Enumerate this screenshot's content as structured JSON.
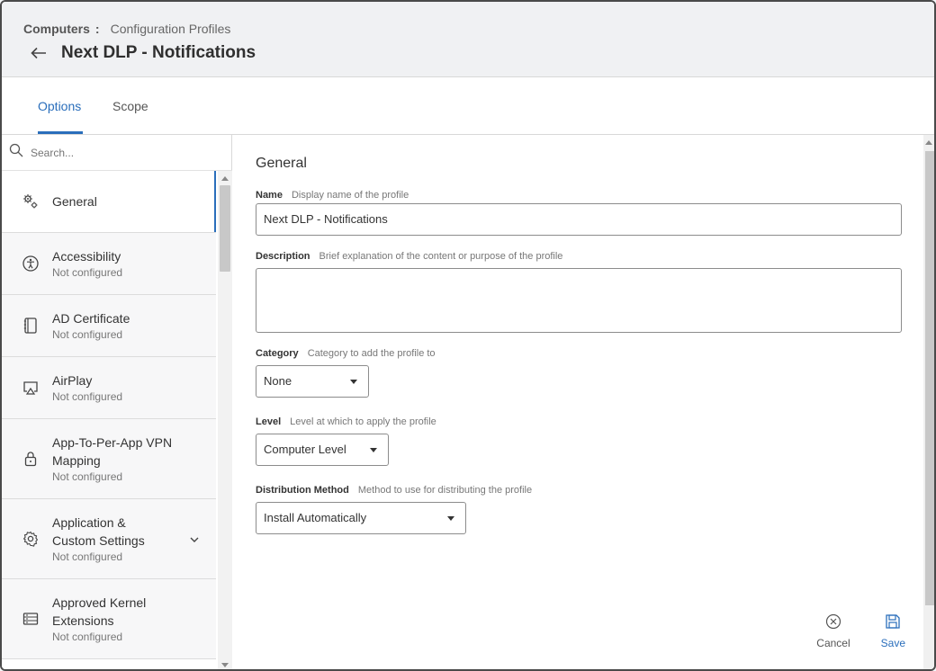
{
  "header": {
    "breadcrumb_root": "Computers",
    "breadcrumb_sep": ":",
    "breadcrumb_current": "Configuration Profiles",
    "title": "Next DLP - Notifications"
  },
  "tabs": [
    {
      "label": "Options",
      "active": true
    },
    {
      "label": "Scope",
      "active": false
    }
  ],
  "sidebar": {
    "search_placeholder": "Search...",
    "items": [
      {
        "label": "General",
        "label2": "",
        "sub": "",
        "icon": "gears-icon",
        "active": true
      },
      {
        "label": "Accessibility",
        "label2": "",
        "sub": "Not configured",
        "icon": "accessibility-icon"
      },
      {
        "label": "AD Certificate",
        "label2": "",
        "sub": "Not configured",
        "icon": "certificate-icon"
      },
      {
        "label": "AirPlay",
        "label2": "",
        "sub": "Not configured",
        "icon": "airplay-icon"
      },
      {
        "label": "App-To-Per-App VPN",
        "label2": "Mapping",
        "sub": "Not configured",
        "icon": "lock-icon"
      },
      {
        "label": "Application &",
        "label2": "Custom Settings",
        "sub": "Not configured",
        "icon": "settings-gear-icon",
        "expandable": true
      },
      {
        "label": "Approved Kernel",
        "label2": "Extensions",
        "sub": "Not configured",
        "icon": "kernel-extension-icon"
      }
    ]
  },
  "main": {
    "section_title": "General",
    "name": {
      "label": "Name",
      "help": "Display name of the profile",
      "value": "Next DLP - Notifications"
    },
    "description": {
      "label": "Description",
      "help": "Brief explanation of the content or purpose of the profile",
      "value": ""
    },
    "category": {
      "label": "Category",
      "help": "Category to add the profile to",
      "value": "None"
    },
    "level": {
      "label": "Level",
      "help": "Level at which to apply the profile",
      "value": "Computer Level"
    },
    "distribution": {
      "label": "Distribution Method",
      "help": "Method to use for distributing the profile",
      "value": "Install Automatically"
    },
    "cancel_label": "Cancel",
    "save_label": "Save"
  },
  "colors": {
    "accent": "#2a6ebb",
    "header_bg": "#f0f1f3",
    "border": "#8c8c8c"
  }
}
